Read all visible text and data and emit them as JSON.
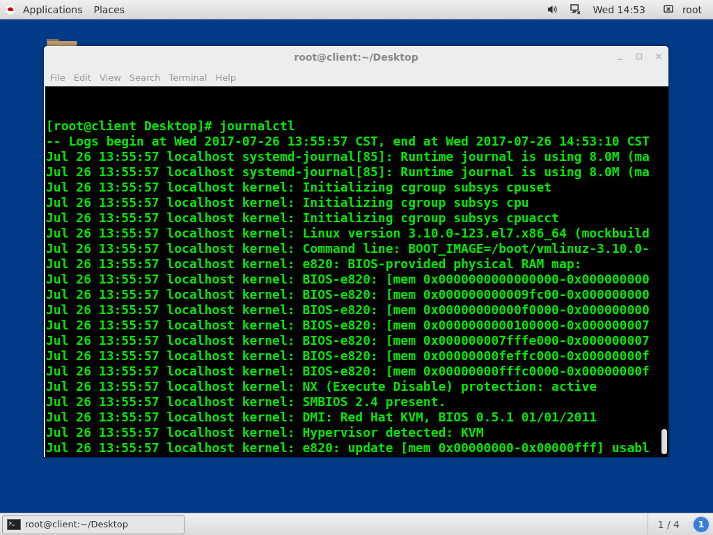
{
  "top_bar": {
    "menus": [
      "Applications",
      "Places"
    ],
    "clock": "Wed 14:53",
    "user": "root"
  },
  "window": {
    "title": "root@client:~/Desktop",
    "menu": [
      "File",
      "Edit",
      "View",
      "Search",
      "Terminal",
      "Help"
    ]
  },
  "terminal": {
    "lines": [
      "[root@client Desktop]# journalctl",
      "-- Logs begin at Wed 2017-07-26 13:55:57 CST, end at Wed 2017-07-26 14:53:10 CST",
      "Jul 26 13:55:57 localhost systemd-journal[85]: Runtime journal is using 8.0M (ma",
      "Jul 26 13:55:57 localhost systemd-journal[85]: Runtime journal is using 8.0M (ma",
      "Jul 26 13:55:57 localhost kernel: Initializing cgroup subsys cpuset",
      "Jul 26 13:55:57 localhost kernel: Initializing cgroup subsys cpu",
      "Jul 26 13:55:57 localhost kernel: Initializing cgroup subsys cpuacct",
      "Jul 26 13:55:57 localhost kernel: Linux version 3.10.0-123.el7.x86_64 (mockbuild",
      "Jul 26 13:55:57 localhost kernel: Command line: BOOT_IMAGE=/boot/vmlinuz-3.10.0-",
      "Jul 26 13:55:57 localhost kernel: e820: BIOS-provided physical RAM map:",
      "Jul 26 13:55:57 localhost kernel: BIOS-e820: [mem 0x0000000000000000-0x000000000",
      "Jul 26 13:55:57 localhost kernel: BIOS-e820: [mem 0x000000000009fc00-0x000000000",
      "Jul 26 13:55:57 localhost kernel: BIOS-e820: [mem 0x00000000000f0000-0x000000000",
      "Jul 26 13:55:57 localhost kernel: BIOS-e820: [mem 0x0000000000100000-0x000000007",
      "Jul 26 13:55:57 localhost kernel: BIOS-e820: [mem 0x000000007fffe000-0x000000007",
      "Jul 26 13:55:57 localhost kernel: BIOS-e820: [mem 0x00000000feffc000-0x00000000f",
      "Jul 26 13:55:57 localhost kernel: BIOS-e820: [mem 0x00000000fffc0000-0x00000000f",
      "Jul 26 13:55:57 localhost kernel: NX (Execute Disable) protection: active",
      "Jul 26 13:55:57 localhost kernel: SMBIOS 2.4 present.",
      "Jul 26 13:55:57 localhost kernel: DMI: Red Hat KVM, BIOS 0.5.1 01/01/2011",
      "Jul 26 13:55:57 localhost kernel: Hypervisor detected: KVM",
      "Jul 26 13:55:57 localhost kernel: e820: update [mem 0x00000000-0x00000fff] usabl"
    ]
  },
  "taskbar": {
    "task": "root@client:~/Desktop",
    "workspace": "1 / 4",
    "badge": "1"
  }
}
